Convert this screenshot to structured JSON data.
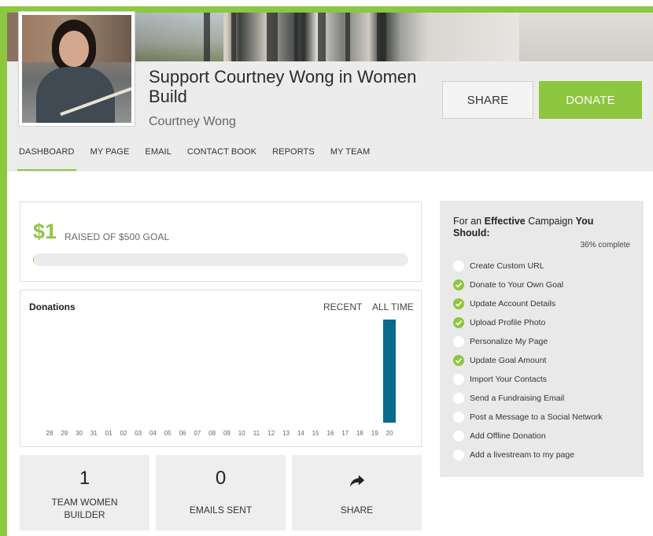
{
  "header": {
    "title": "Support Courtney Wong in Women Build",
    "owner": "Courtney Wong",
    "share_label": "SHARE",
    "donate_label": "DONATE"
  },
  "tabs": [
    {
      "label": "DASHBOARD",
      "active": true
    },
    {
      "label": "MY PAGE",
      "active": false
    },
    {
      "label": "EMAIL",
      "active": false
    },
    {
      "label": "CONTACT BOOK",
      "active": false
    },
    {
      "label": "REPORTS",
      "active": false
    },
    {
      "label": "MY TEAM",
      "active": false
    }
  ],
  "goal": {
    "amount": "$1",
    "text": "RAISED OF $500 GOAL",
    "progress_fraction": 0.002
  },
  "donations": {
    "title": "Donations",
    "tab_recent": "RECENT",
    "tab_all_time": "ALL TIME"
  },
  "chart_data": {
    "type": "bar",
    "title": "Donations",
    "categories": [
      "28",
      "29",
      "30",
      "31",
      "01",
      "02",
      "03",
      "04",
      "05",
      "06",
      "07",
      "08",
      "09",
      "10",
      "11",
      "12",
      "13",
      "14",
      "15",
      "16",
      "17",
      "18",
      "19",
      "20"
    ],
    "values": [
      0,
      0,
      0,
      0,
      0,
      0,
      0,
      0,
      0,
      0,
      0,
      0,
      0,
      0,
      0,
      0,
      0,
      0,
      0,
      0,
      0,
      0,
      0,
      1
    ],
    "ylim": [
      0,
      1
    ],
    "grid": false,
    "bar_color": "#0b6a8a"
  },
  "stats": [
    {
      "value": "1",
      "label": "TEAM WOMEN BUILDER"
    },
    {
      "value": "0",
      "label": "EMAILS SENT"
    },
    {
      "label": "SHARE",
      "icon": "share-arrow-icon"
    }
  ],
  "checklist": {
    "heading_pre": "For an ",
    "heading_bold1": "Effective",
    "heading_mid": " Campaign ",
    "heading_bold2": "You Should:",
    "percent": "36% complete",
    "items": [
      {
        "label": "Create Custom URL",
        "done": false
      },
      {
        "label": "Donate to Your Own Goal",
        "done": true
      },
      {
        "label": "Update Account Details",
        "done": true
      },
      {
        "label": "Upload Profile Photo",
        "done": true
      },
      {
        "label": "Personalize My Page",
        "done": false
      },
      {
        "label": "Update Goal Amount",
        "done": true
      },
      {
        "label": "Import Your Contacts",
        "done": false
      },
      {
        "label": "Send a Fundraising Email",
        "done": false
      },
      {
        "label": "Post a Message to a Social Network",
        "done": false
      },
      {
        "label": "Add Offline Donation",
        "done": false
      },
      {
        "label": "Add a livestream to my page",
        "done": false
      }
    ]
  },
  "colors": {
    "accent": "#8dc63f",
    "bar": "#0b6a8a"
  }
}
